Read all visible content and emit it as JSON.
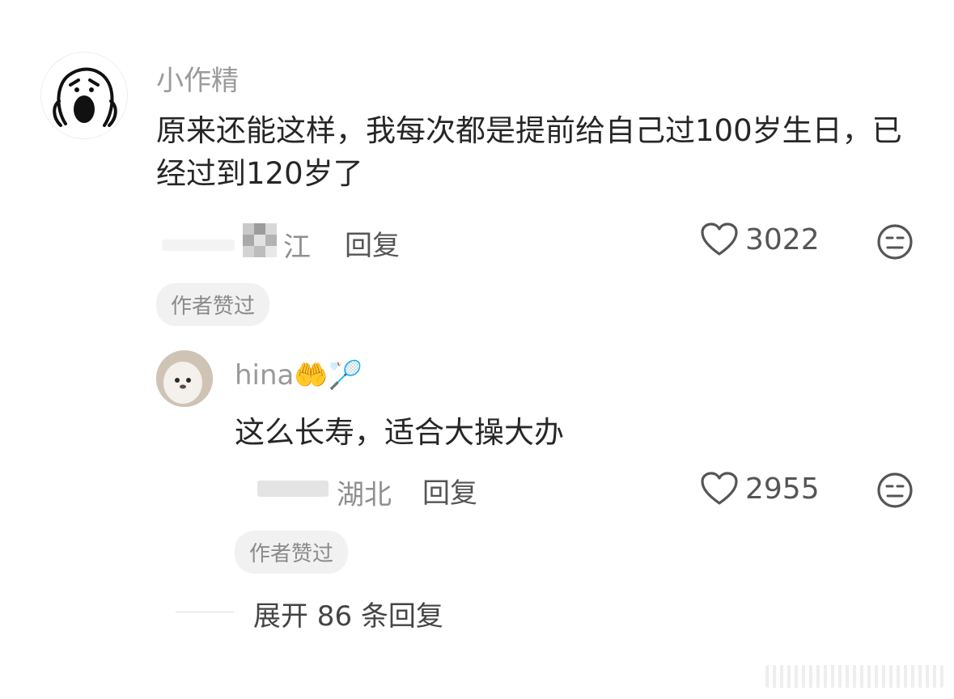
{
  "comment": {
    "username": "小作精",
    "text": "原来还能这样，我每次都是提前给自己过100岁生日，已经过到120岁了",
    "location": "江",
    "reply_label": "回复",
    "like_count": "3022",
    "author_liked_badge": "作者赞过"
  },
  "reply": {
    "username": "hina🤲🏸",
    "text": "这么长寿，适合大操大办",
    "location": "湖北",
    "reply_label": "回复",
    "like_count": "2955",
    "author_liked_badge": "作者赞过"
  },
  "expand": {
    "label": "展开 86 条回复"
  },
  "icons": {
    "like": "heart-icon",
    "dislike": "unamused-face-icon"
  },
  "colors": {
    "text_primary": "#262626",
    "text_secondary": "#9a9a9a",
    "badge_bg": "#f1f1f1"
  }
}
